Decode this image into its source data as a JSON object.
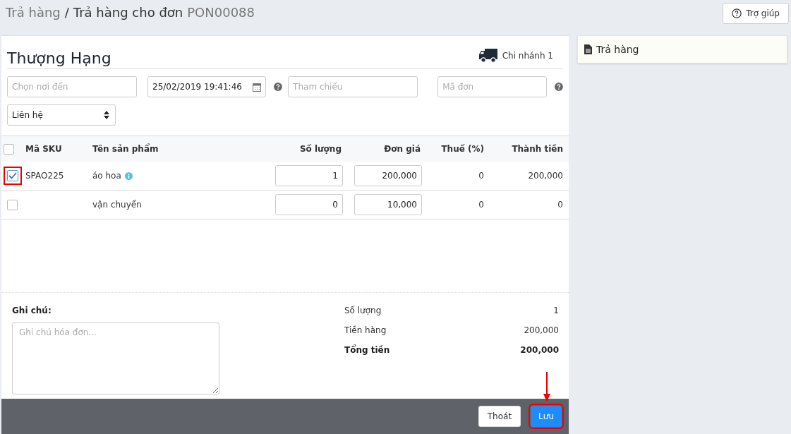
{
  "breadcrumb": {
    "parent": "Trả hàng",
    "separator": "/",
    "current": "Trả hàng cho đơn",
    "order_code": "PON00088"
  },
  "help_button": "Trợ giúp",
  "customer": {
    "name": "Thượng Hạng",
    "branch": "Chi nhánh 1"
  },
  "fields": {
    "destination": {
      "placeholder": "Chọn nơi đến"
    },
    "date": {
      "value": "25/02/2019 19:41:46"
    },
    "reference": {
      "placeholder": "Tham chiếu"
    },
    "order_code": {
      "placeholder": "Mã đơn"
    },
    "contact": {
      "value": "Liên hệ"
    }
  },
  "table": {
    "columns": [
      "Mã SKU",
      "Tên sản phẩm",
      "Số lượng",
      "Đơn giá",
      "Thuế (%)",
      "Thành tiền"
    ],
    "select_all": {
      "checked": false
    },
    "rows": [
      {
        "checked": true,
        "highlighted": true,
        "sku": "SPAO225",
        "name": "áo hoa",
        "info": true,
        "quantity": "1",
        "price": "200,000",
        "tax": "0",
        "total": "200,000"
      },
      {
        "checked": false,
        "highlighted": false,
        "sku": "",
        "name": "vận chuyển",
        "info": false,
        "quantity": "0",
        "price": "10,000",
        "tax": "0",
        "total": "0"
      }
    ]
  },
  "notes": {
    "label": "Ghi chú:",
    "placeholder": "Ghi chú hóa đơn..."
  },
  "summary": [
    {
      "label": "Số lượng",
      "value": "1",
      "bold": false
    },
    {
      "label": "Tiền hàng",
      "value": "200,000",
      "bold": false
    },
    {
      "label": "Tổng tiền",
      "value": "200,000",
      "bold": true
    }
  ],
  "footer": {
    "buttons": [
      {
        "label": "Thoát",
        "kind": "default",
        "highlighted": false
      },
      {
        "label": "Lưu",
        "kind": "primary",
        "highlighted": true
      }
    ]
  },
  "side_panel": {
    "title": "Trả hàng"
  }
}
